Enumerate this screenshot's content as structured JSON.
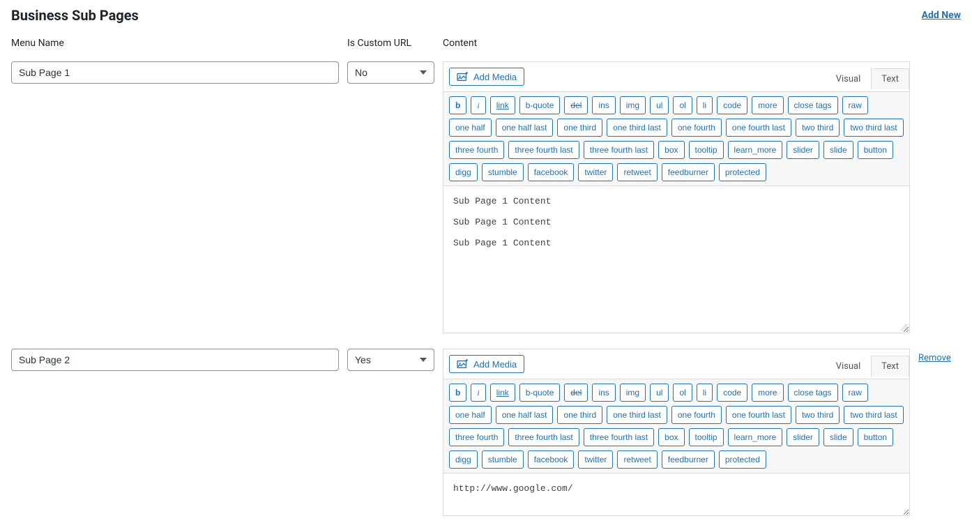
{
  "page_title": "Business Sub Pages",
  "add_new_label": "Add New",
  "columns": {
    "menu_name": "Menu Name",
    "is_custom_url": "Is Custom URL",
    "content": "Content"
  },
  "editor": {
    "add_media_label": "Add Media",
    "tabs": {
      "visual": "Visual",
      "text": "Text"
    },
    "quicktags": [
      {
        "key": "b",
        "label": "b",
        "class": "qt-b"
      },
      {
        "key": "i",
        "label": "i",
        "class": "qt-i"
      },
      {
        "key": "link",
        "label": "link",
        "class": "qt-link"
      },
      {
        "key": "b-quote",
        "label": "b-quote"
      },
      {
        "key": "del",
        "label": "del",
        "class": "qt-del"
      },
      {
        "key": "ins",
        "label": "ins"
      },
      {
        "key": "img",
        "label": "img"
      },
      {
        "key": "ul",
        "label": "ul"
      },
      {
        "key": "ol",
        "label": "ol"
      },
      {
        "key": "li",
        "label": "li"
      },
      {
        "key": "code",
        "label": "code"
      },
      {
        "key": "more",
        "label": "more"
      },
      {
        "key": "close-tags",
        "label": "close tags"
      },
      {
        "key": "raw",
        "label": "raw"
      },
      {
        "key": "one-half",
        "label": "one half"
      },
      {
        "key": "one-half-last",
        "label": "one half last"
      },
      {
        "key": "one-third",
        "label": "one third"
      },
      {
        "key": "one-third-last",
        "label": "one third last"
      },
      {
        "key": "one-fourth",
        "label": "one fourth"
      },
      {
        "key": "one-fourth-last",
        "label": "one fourth last"
      },
      {
        "key": "two-third",
        "label": "two third"
      },
      {
        "key": "two-third-last",
        "label": "two third last"
      },
      {
        "key": "three-fourth",
        "label": "three fourth"
      },
      {
        "key": "three-fourth-last",
        "label": "three fourth last"
      },
      {
        "key": "three-fourth-last2",
        "label": "three fourth last"
      },
      {
        "key": "box",
        "label": "box"
      },
      {
        "key": "tooltip",
        "label": "tooltip"
      },
      {
        "key": "learn-more",
        "label": "learn_more"
      },
      {
        "key": "slider",
        "label": "slider"
      },
      {
        "key": "slide",
        "label": "slide"
      },
      {
        "key": "button",
        "label": "button"
      },
      {
        "key": "digg",
        "label": "digg"
      },
      {
        "key": "stumble",
        "label": "stumble"
      },
      {
        "key": "facebook",
        "label": "facebook"
      },
      {
        "key": "twitter",
        "label": "twitter"
      },
      {
        "key": "retweet",
        "label": "retweet"
      },
      {
        "key": "feedburner",
        "label": "feedburner"
      },
      {
        "key": "protected",
        "label": "protected"
      }
    ]
  },
  "select_options": {
    "no": "No",
    "yes": "Yes"
  },
  "rows": [
    {
      "menu_name": "Sub Page 1",
      "custom_url": "No",
      "content": "Sub Page 1 Content\n\nSub Page 1 Content\n\nSub Page 1 Content",
      "remove_label": ""
    },
    {
      "menu_name": "Sub Page 2",
      "custom_url": "Yes",
      "content": "http://www.google.com/",
      "remove_label": "Remove"
    }
  ]
}
